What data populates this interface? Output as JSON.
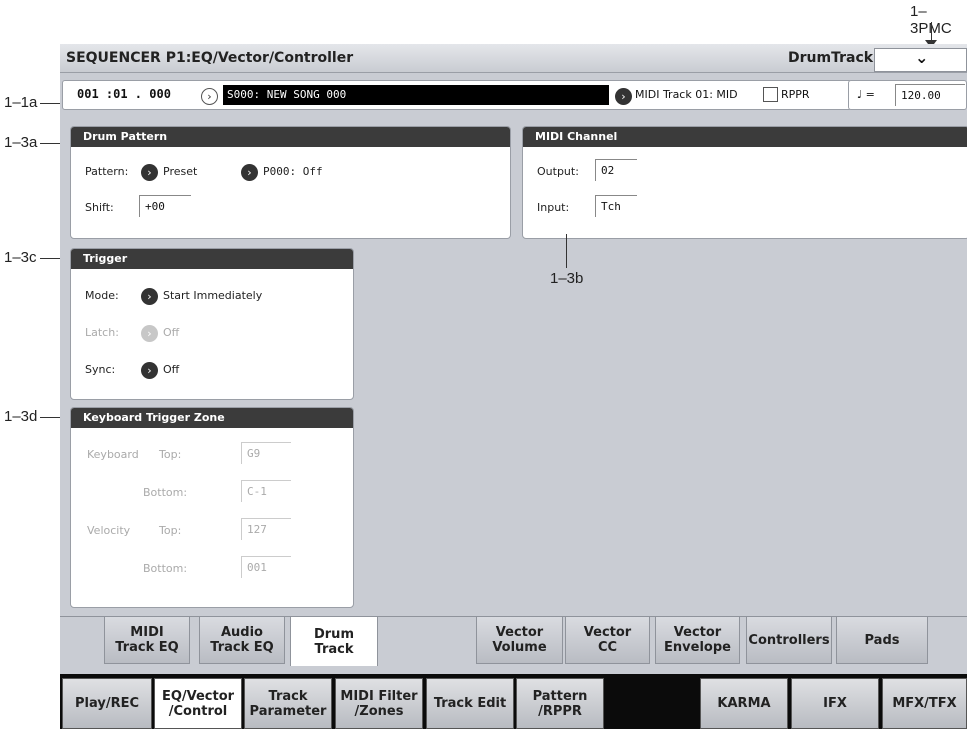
{
  "callouts": {
    "pmc": "1–3PMC",
    "a1": "1–1a",
    "a3": "1–3a",
    "b3": "1–3b",
    "c3": "1–3c",
    "d3": "1–3d"
  },
  "titlebar": {
    "title": "SEQUENCER P1:EQ/Vector/Controller",
    "page_name": "DrumTrack",
    "menu_symbol": "⌄"
  },
  "song_row": {
    "location": "001 :01 . 000",
    "song": "S000: NEW SONG 000",
    "track": "MIDI Track 01: MID",
    "rppr_label": "RPPR",
    "tempo_symbol": "♩ =",
    "tempo": "120.00"
  },
  "drum_pattern": {
    "title": "Drum Pattern",
    "pattern_label": "Pattern:",
    "pattern_bank": "Preset",
    "pattern_value": "P000: Off",
    "shift_label": "Shift:",
    "shift_value": "+00"
  },
  "midi_channel": {
    "title": "MIDI Channel",
    "output_label": "Output:",
    "output_value": "02",
    "input_label": "Input:",
    "input_value": "Tch"
  },
  "trigger": {
    "title": "Trigger",
    "mode_label": "Mode:",
    "mode_value": "Start Immediately",
    "latch_label": "Latch:",
    "latch_value": "Off",
    "sync_label": "Sync:",
    "sync_value": "Off"
  },
  "keyboard_zone": {
    "title": "Keyboard Trigger Zone",
    "keyboard_label": "Keyboard",
    "velocity_label": "Velocity",
    "top_label": "Top:",
    "bottom_label": "Bottom:",
    "kb_top": "G9",
    "kb_bottom": "C-1",
    "vel_top": "127",
    "vel_bottom": "001"
  },
  "page_tabs": [
    {
      "l1": "MIDI",
      "l2": "Track EQ"
    },
    {
      "l1": "Audio",
      "l2": "Track EQ"
    },
    {
      "l1": "Drum",
      "l2": "Track"
    },
    {
      "l1": "Vector",
      "l2": "Volume"
    },
    {
      "l1": "Vector",
      "l2": "CC"
    },
    {
      "l1": "Vector",
      "l2": "Envelope"
    },
    {
      "l1": "Controllers",
      "l2": ""
    },
    {
      "l1": "Pads",
      "l2": ""
    }
  ],
  "group_tabs": [
    {
      "l1": "Play/REC",
      "l2": ""
    },
    {
      "l1": "EQ/Vector",
      "l2": "/Control"
    },
    {
      "l1": "Track",
      "l2": "Parameter"
    },
    {
      "l1": "MIDI Filter",
      "l2": "/Zones"
    },
    {
      "l1": "Track Edit",
      "l2": ""
    },
    {
      "l1": "Pattern",
      "l2": "/RPPR"
    },
    {
      "l1": "KARMA",
      "l2": ""
    },
    {
      "l1": "IFX",
      "l2": ""
    },
    {
      "l1": "MFX/TFX",
      "l2": ""
    }
  ],
  "colors": {
    "screen_bg": "#c9ccd3",
    "header_bg": "#3b3b3b",
    "song_bar": "#000000"
  }
}
